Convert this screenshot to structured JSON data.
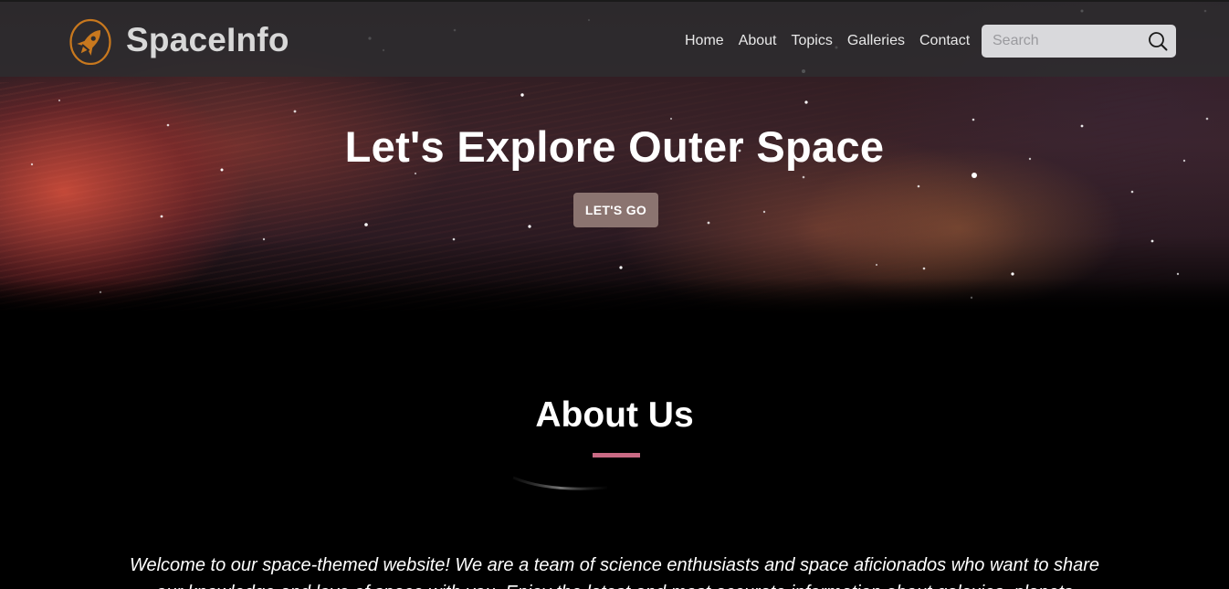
{
  "header": {
    "brand_name": "SpaceInfo",
    "logo_icon": "rocket-icon",
    "nav": [
      {
        "label": "Home"
      },
      {
        "label": "About"
      },
      {
        "label": "Topics"
      },
      {
        "label": "Galleries"
      },
      {
        "label": "Contact"
      }
    ],
    "search": {
      "placeholder": "Search",
      "value": "",
      "icon": "search-icon"
    }
  },
  "hero": {
    "title": "Let's Explore Outer Space",
    "button_label": "LET'S GO"
  },
  "about": {
    "title": "About Us",
    "text": "Welcome to our space-themed website! We are a team of science enthusiasts and space aficionados who want to share our knowledge and love of space with you. Enjoy the latest and most accurate information about galaxies, planets"
  },
  "colors": {
    "accent": "#c96a84",
    "button": "#8b7470",
    "logo": "#c8781e",
    "navbar": "#2d2d30",
    "background": "#000000"
  }
}
